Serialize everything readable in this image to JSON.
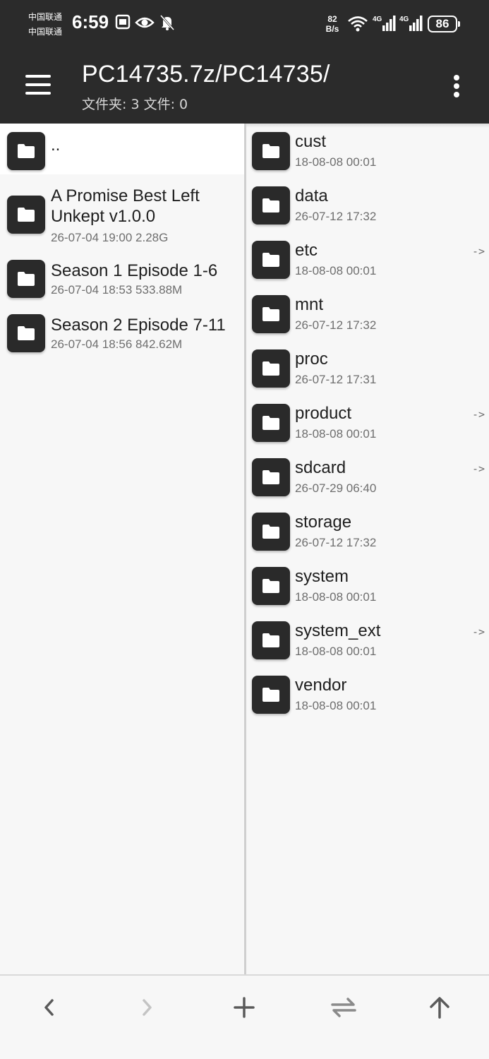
{
  "status_bar": {
    "carrier_1": "中国联通",
    "carrier_2": "中国联通",
    "time": "6:59",
    "net_speed_value": "82",
    "net_speed_unit": "B/s",
    "signal_1_label": "4G",
    "signal_2_label": "4G",
    "battery": "86"
  },
  "app_bar": {
    "title": "PC14735.7z/PC14735/",
    "subtitle": "文件夹: 3  文件: 0"
  },
  "left_panel": {
    "items": [
      {
        "name": "..",
        "meta": ""
      },
      {
        "name": "A Promise Best Left Unkept v1.0.0",
        "name_line1": "A Promise Best Left",
        "name_line2": "Unkept v1.0.0",
        "meta": "26-07-04 19:00  2.28G"
      },
      {
        "name": "Season 1 Episode 1-6",
        "meta": "26-07-04 18:53  533.88M"
      },
      {
        "name": "Season 2 Episode 7-11",
        "meta": "26-07-04 18:56  842.62M"
      }
    ]
  },
  "right_panel": {
    "items": [
      {
        "name": "cust",
        "meta": "18-08-08 00:01",
        "link": ""
      },
      {
        "name": "data",
        "meta": "26-07-12 17:32",
        "link": ""
      },
      {
        "name": "etc",
        "meta": "18-08-08 00:01",
        "link": "->"
      },
      {
        "name": "mnt",
        "meta": "26-07-12 17:32",
        "link": ""
      },
      {
        "name": "proc",
        "meta": "26-07-12 17:31",
        "link": ""
      },
      {
        "name": "product",
        "meta": "18-08-08 00:01",
        "link": "->"
      },
      {
        "name": "sdcard",
        "meta": "26-07-29 06:40",
        "link": "->"
      },
      {
        "name": "storage",
        "meta": "26-07-12 17:32",
        "link": ""
      },
      {
        "name": "system",
        "meta": "18-08-08 00:01",
        "link": ""
      },
      {
        "name": "system_ext",
        "meta": "18-08-08 00:01",
        "link": "->"
      },
      {
        "name": "vendor",
        "meta": "18-08-08 00:01",
        "link": ""
      }
    ]
  },
  "bottom_bar": {
    "icons": [
      "chevron-left-icon",
      "chevron-right-icon",
      "plus-icon",
      "swap-icon",
      "arrow-up-icon"
    ]
  },
  "colors": {
    "bar_background": "#2b2b2b",
    "panel_background": "#f7f7f7",
    "folder_tile": "#2a2a2a"
  }
}
